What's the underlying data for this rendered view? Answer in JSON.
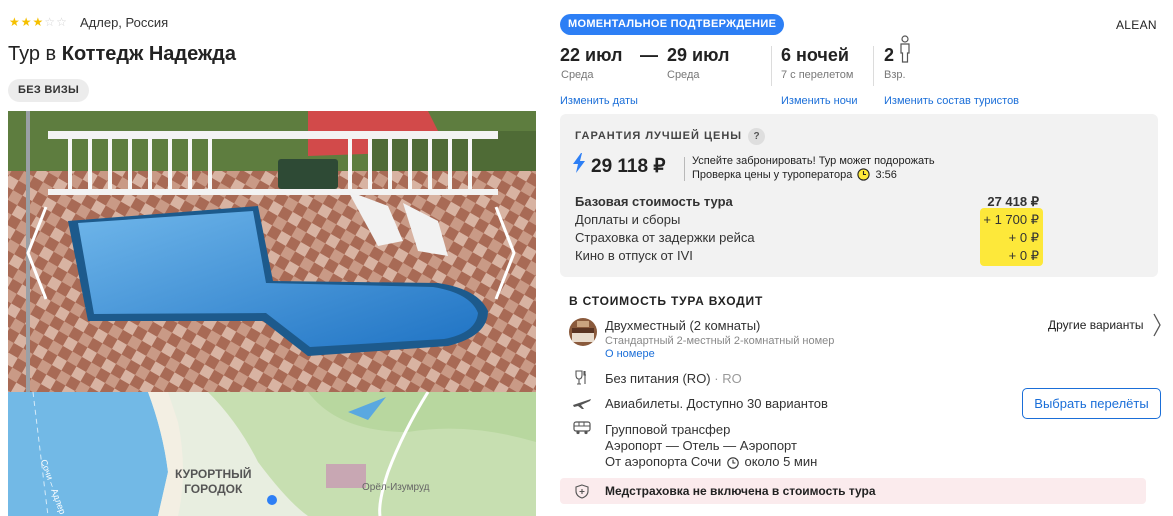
{
  "hotel": {
    "stars": 3,
    "max_stars": 5,
    "location": "Адлер, Россия",
    "title_prefix": "Тур в",
    "title_name": "Коттедж Надежда",
    "visa_badge": "БЕЗ ВИЗЫ"
  },
  "map": {
    "label_line1": "КУРОРТНЫЙ",
    "label_line2": "ГОРОДОК",
    "label_village": "Орёл-Изумруд",
    "label_road": "Сочи – Адлер"
  },
  "tour": {
    "instant_badge": "МОМЕНТАЛЬНОЕ ПОДТВЕРЖДЕНИЕ",
    "operator": "ALEAN",
    "date_from": "22 июл",
    "date_sep": "—",
    "date_to": "29 июл",
    "day_from": "Среда",
    "day_to": "Среда",
    "nights": "6 ночей",
    "nights_sub": "7 с перелетом",
    "adults": "2",
    "adults_sub": "Взр.",
    "link_dates": "Изменить даты",
    "link_nights": "Изменить ночи",
    "link_tourists": "Изменить состав туристов"
  },
  "price": {
    "guarantee": "ГАРАНТИЯ ЛУЧШЕЙ ЦЕНЫ",
    "help": "?",
    "total": "29 118 ₽",
    "hint_line1": "Успейте забронировать! Тур может подорожать",
    "hint_line2": "Проверка цены у туроператора",
    "timer": "3:56",
    "breakdown": [
      {
        "label": "Базовая стоимость тура",
        "value": "27 418 ₽",
        "bold": true
      },
      {
        "label": "Доплаты и сборы",
        "value": "+ 1 700 ₽"
      },
      {
        "label": "Страховка от задержки рейса",
        "value": "+ 0 ₽"
      },
      {
        "label": "Кино в отпуск от IVI",
        "value": "+ 0 ₽"
      }
    ]
  },
  "included": {
    "title": "В СТОИМОСТЬ ТУРА ВХОДИТ",
    "room": "Двухместный (2 комнаты)",
    "room_sub": "Стандартный 2-местный 2-комнатный номер",
    "room_link": "О номере",
    "other_variants": "Другие варианты",
    "meal": "Без питания (RO)",
    "meal_sep": "·",
    "meal_code": "RO",
    "flights": "Авиабилеты. Доступно 30 вариантов",
    "choose_flights": "Выбрать перелёты",
    "transfer": "Групповой трансфер",
    "transfer_route": "Аэропорт — Отель — Аэропорт",
    "transfer_time_prefix": "От аэропорта Сочи",
    "transfer_time": "около 5 мин",
    "insurance": "Медстраховка не включена в стоимость тура"
  },
  "colors": {
    "accent": "#2d7ff5",
    "link": "#1a6ed8",
    "highlight": "#fde83a",
    "warning_bg": "#fbebed",
    "star": "#f5c000"
  }
}
